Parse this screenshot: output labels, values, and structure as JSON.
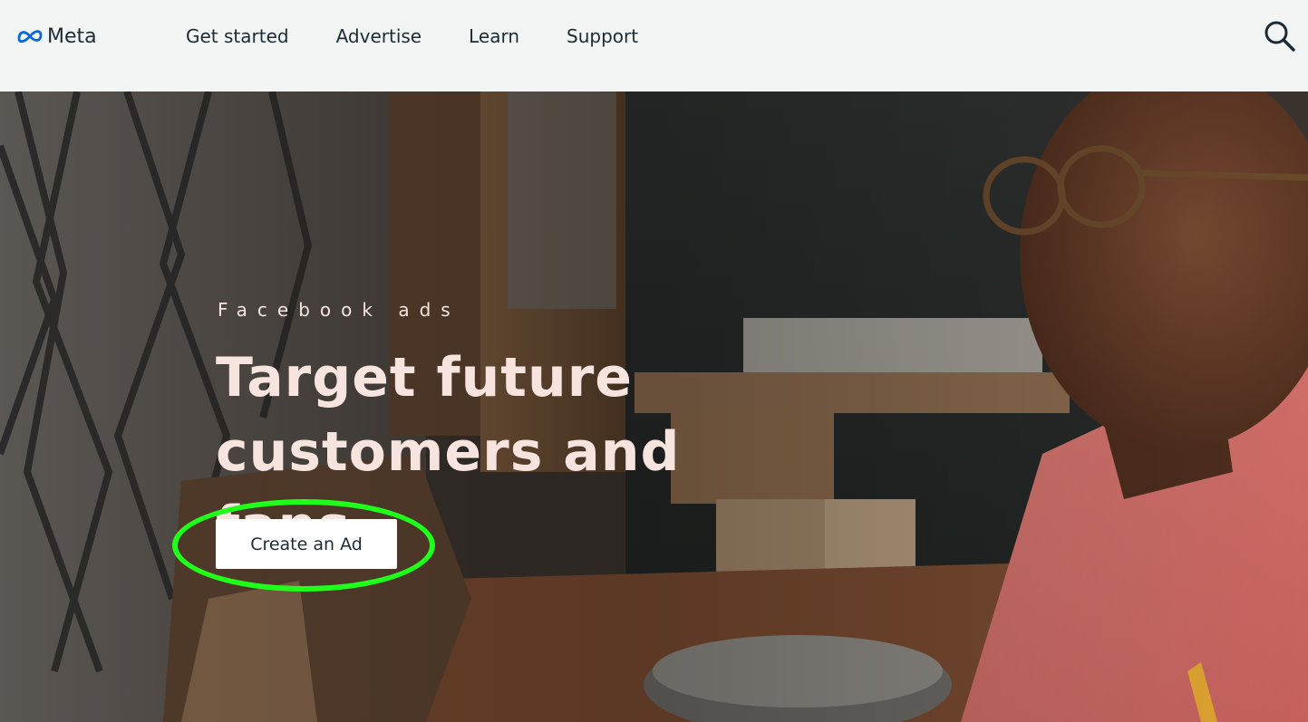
{
  "header": {
    "logo_text": "Meta",
    "nav": [
      {
        "label": "Get started"
      },
      {
        "label": "Advertise"
      },
      {
        "label": "Learn"
      },
      {
        "label": "Support"
      }
    ],
    "search_icon": "search-icon"
  },
  "hero": {
    "eyebrow": "Facebook ads",
    "headline_line1": "Target future",
    "headline_line2": "customers and fans.",
    "cta_label": "Create an Ad"
  },
  "colors": {
    "topbar_bg": "#f3f5f4",
    "nav_text": "#1c2b33",
    "meta_blue": "#0668e1",
    "hero_text": "#f7e4df",
    "highlight": "#1fff1a",
    "button_bg": "#ffffff"
  }
}
